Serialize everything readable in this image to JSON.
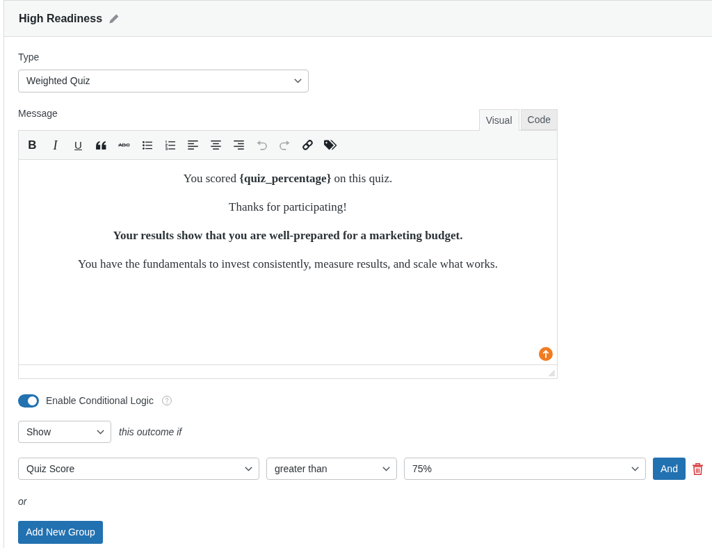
{
  "header": {
    "title": "High Readiness"
  },
  "type_field": {
    "label": "Type",
    "value": "Weighted Quiz"
  },
  "message": {
    "label": "Message",
    "tabs": [
      {
        "label": "Visual",
        "selected": true
      },
      {
        "label": "Code",
        "selected": false
      }
    ],
    "toolbar": [
      {
        "kind": "bold",
        "label": "B",
        "disabled": false
      },
      {
        "kind": "italic",
        "label": "I",
        "disabled": false
      },
      {
        "kind": "underline",
        "label": "U",
        "disabled": false
      },
      {
        "kind": "quote",
        "disabled": false
      },
      {
        "kind": "strikethrough",
        "label": "ABC",
        "disabled": false
      },
      {
        "kind": "bullet_list",
        "disabled": false
      },
      {
        "kind": "numbered_list",
        "disabled": false
      },
      {
        "kind": "align_left",
        "disabled": false
      },
      {
        "kind": "align_center",
        "disabled": false
      },
      {
        "kind": "align_right",
        "disabled": false
      },
      {
        "kind": "undo",
        "disabled": true
      },
      {
        "kind": "redo",
        "disabled": true
      },
      {
        "kind": "link",
        "disabled": false
      },
      {
        "kind": "tag",
        "disabled": false
      }
    ],
    "paragraphs": [
      {
        "text": "You scored **{quiz_percentage}** on this quiz.",
        "bold": false
      },
      {
        "text": "Thanks for participating!",
        "bold": false
      },
      {
        "text": "Your results show that you are well-prepared for a marketing budget.",
        "bold": true
      },
      {
        "text": "You have the fundamentals to invest consistently, measure results, and scale what works.",
        "bold": false
      }
    ]
  },
  "conditional_logic": {
    "toggle": {
      "label": "Enable Conditional Logic",
      "on": true
    },
    "action": "Show",
    "action_suffix": "this outcome if",
    "rules": [
      {
        "field": "Quiz Score",
        "operator": "greater than",
        "value": "75%",
        "and_button": "And"
      }
    ],
    "or_label": "or",
    "add_group_button": "Add New Group"
  }
}
